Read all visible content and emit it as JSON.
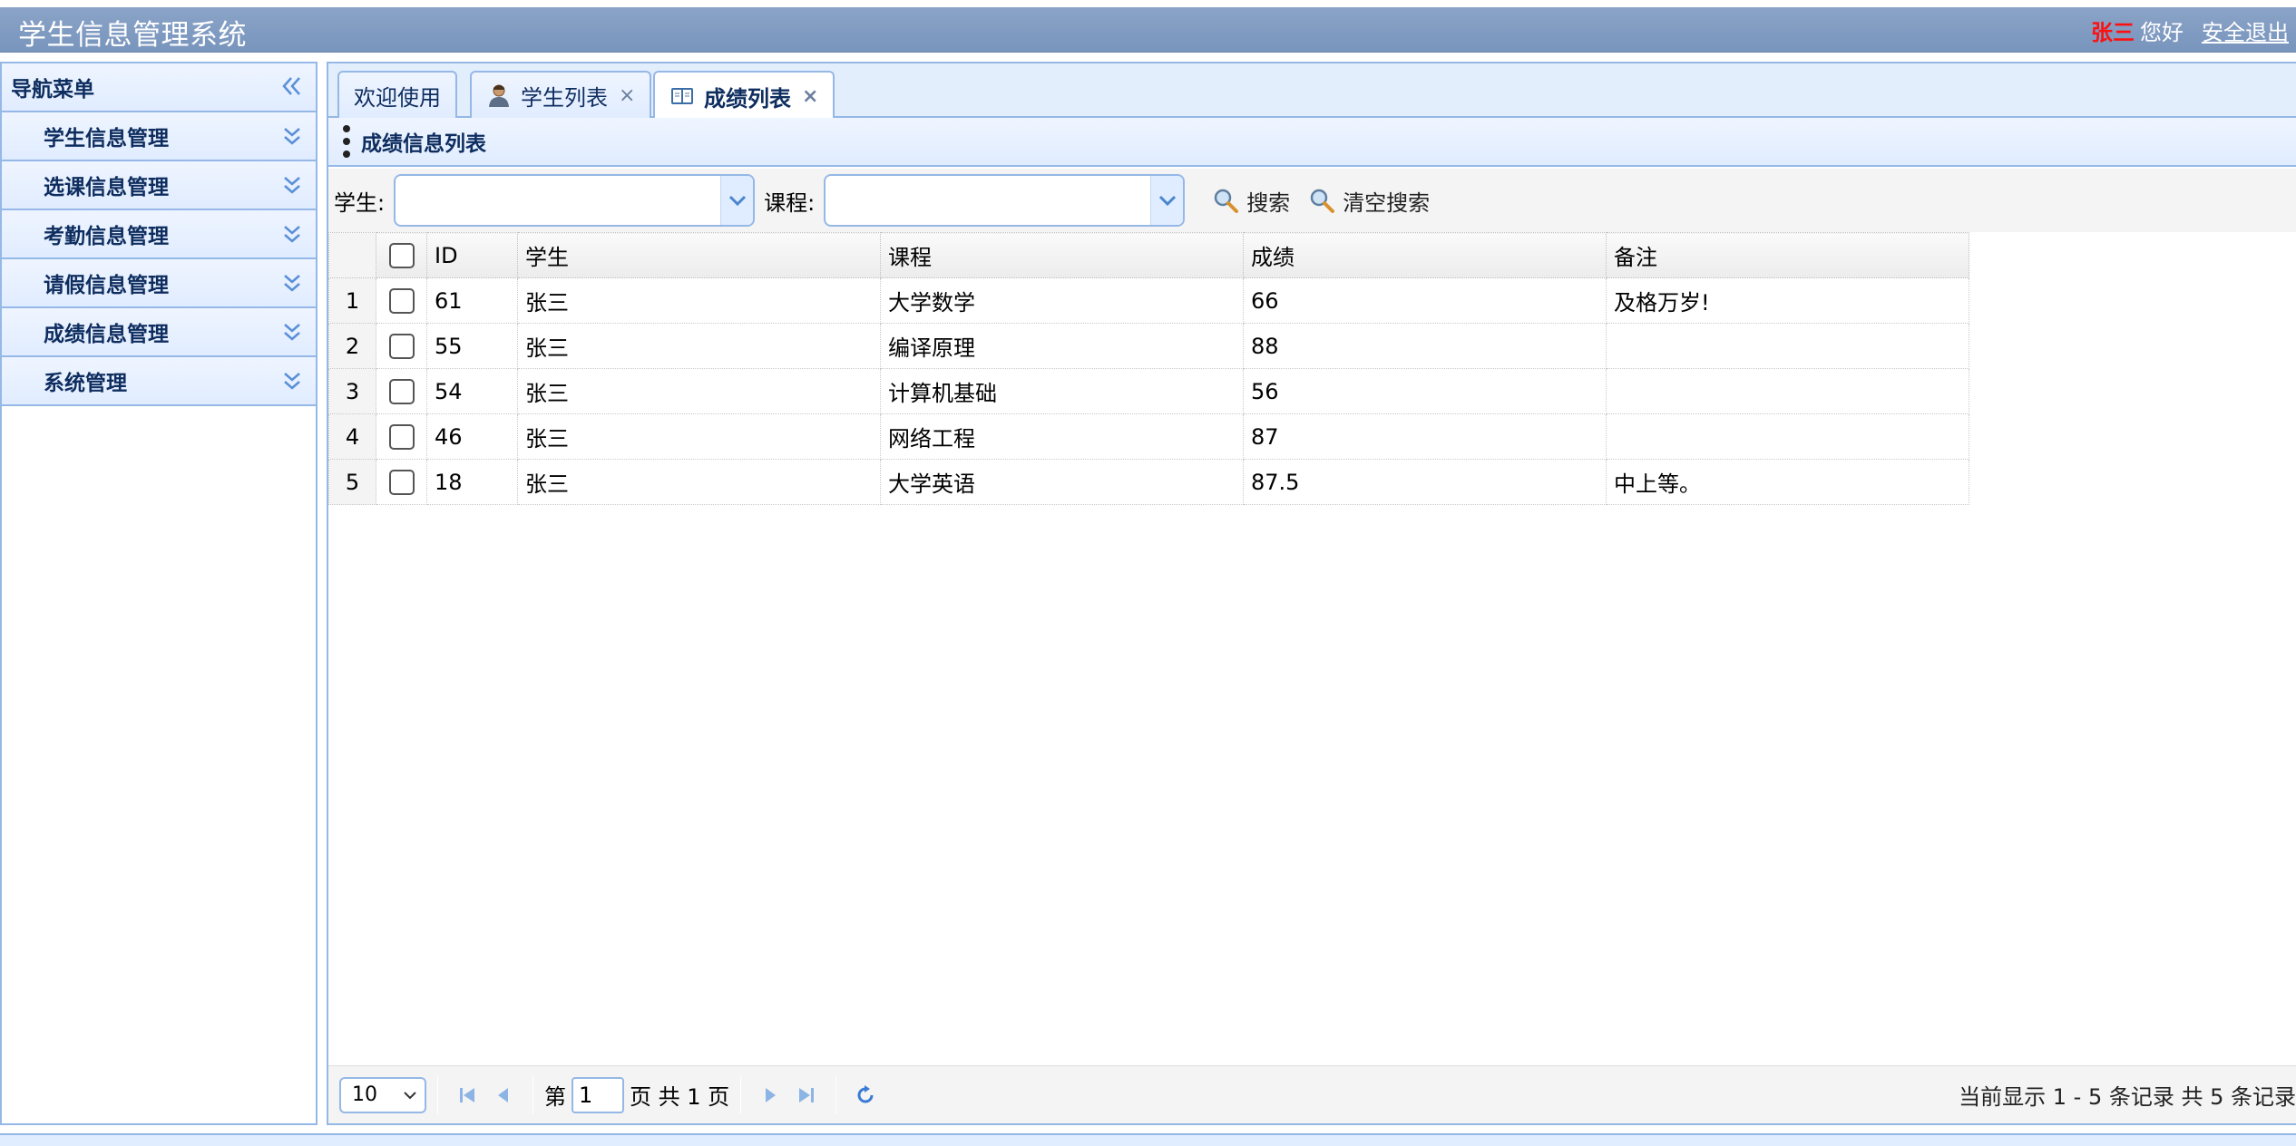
{
  "header": {
    "title": "学生信息管理系统",
    "user_name": "张三",
    "greeting": "您好",
    "logout": "安全退出"
  },
  "sidebar": {
    "title": "导航菜单",
    "items": [
      {
        "label": "学生信息管理"
      },
      {
        "label": "选课信息管理"
      },
      {
        "label": "考勤信息管理"
      },
      {
        "label": "请假信息管理"
      },
      {
        "label": "成绩信息管理"
      },
      {
        "label": "系统管理"
      }
    ]
  },
  "tabs": [
    {
      "label": "欢迎使用"
    },
    {
      "label": "学生列表",
      "close": "×"
    },
    {
      "label": "成绩列表",
      "close": "×"
    }
  ],
  "panel": {
    "title": "成绩信息列表"
  },
  "toolbar": {
    "student_label": "学生:",
    "course_label": "课程:",
    "search": "搜索",
    "clear_search": "清空搜索"
  },
  "grid": {
    "columns": [
      "ID",
      "学生",
      "课程",
      "成绩",
      "备注"
    ],
    "rows": [
      {
        "num": "1",
        "id": "61",
        "student": "张三",
        "course": "大学数学",
        "score": "66",
        "remark": "及格万岁!"
      },
      {
        "num": "2",
        "id": "55",
        "student": "张三",
        "course": "编译原理",
        "score": "88",
        "remark": ""
      },
      {
        "num": "3",
        "id": "54",
        "student": "张三",
        "course": "计算机基础",
        "score": "56",
        "remark": ""
      },
      {
        "num": "4",
        "id": "46",
        "student": "张三",
        "course": "网络工程",
        "score": "87",
        "remark": ""
      },
      {
        "num": "5",
        "id": "18",
        "student": "张三",
        "course": "大学英语",
        "score": "87.5",
        "remark": "中上等。"
      }
    ]
  },
  "pager": {
    "page_size": "10",
    "page_prefix": "第",
    "page_value": "1",
    "page_suffix": "页 共 1 页",
    "info": "当前显示 1 - 5 条记录 共 5 条记录"
  },
  "colors": {
    "header": "#7f9cc4",
    "border": "#95b8e7",
    "panel": "#e0ecff",
    "user_name": "#ff1010"
  }
}
